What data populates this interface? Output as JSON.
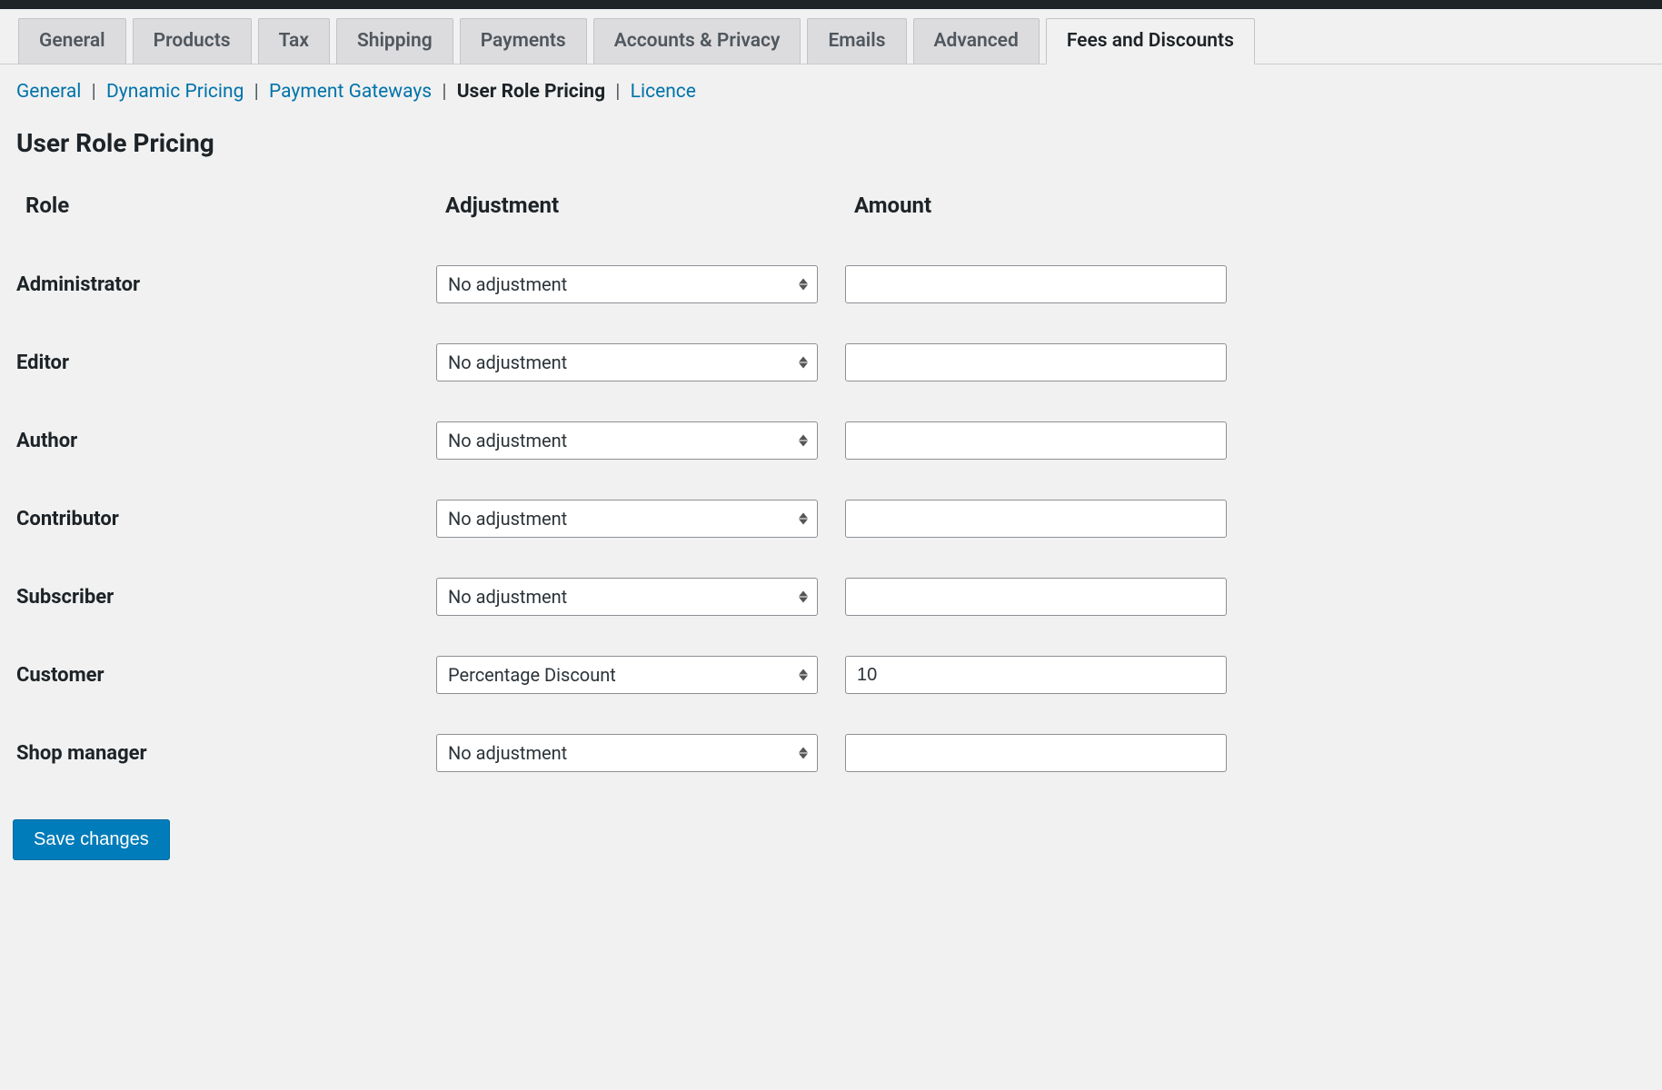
{
  "tabs": {
    "items": [
      {
        "label": "General",
        "active": false
      },
      {
        "label": "Products",
        "active": false
      },
      {
        "label": "Tax",
        "active": false
      },
      {
        "label": "Shipping",
        "active": false
      },
      {
        "label": "Payments",
        "active": false
      },
      {
        "label": "Accounts & Privacy",
        "active": false
      },
      {
        "label": "Emails",
        "active": false
      },
      {
        "label": "Advanced",
        "active": false
      },
      {
        "label": "Fees and Discounts",
        "active": true
      }
    ]
  },
  "subnav": {
    "items": [
      {
        "label": "General",
        "current": false
      },
      {
        "label": "Dynamic Pricing",
        "current": false
      },
      {
        "label": "Payment Gateways",
        "current": false
      },
      {
        "label": "User Role Pricing",
        "current": true
      },
      {
        "label": "Licence",
        "current": false
      }
    ]
  },
  "page": {
    "title": "User Role Pricing"
  },
  "table": {
    "headers": {
      "role": "Role",
      "adjustment": "Adjustment",
      "amount": "Amount"
    },
    "rows": [
      {
        "role": "Administrator",
        "adjustment": "No adjustment",
        "amount": ""
      },
      {
        "role": "Editor",
        "adjustment": "No adjustment",
        "amount": ""
      },
      {
        "role": "Author",
        "adjustment": "No adjustment",
        "amount": ""
      },
      {
        "role": "Contributor",
        "adjustment": "No adjustment",
        "amount": ""
      },
      {
        "role": "Subscriber",
        "adjustment": "No adjustment",
        "amount": ""
      },
      {
        "role": "Customer",
        "adjustment": "Percentage Discount",
        "amount": "10"
      },
      {
        "role": "Shop manager",
        "adjustment": "No adjustment",
        "amount": ""
      }
    ]
  },
  "buttons": {
    "save": "Save changes"
  }
}
